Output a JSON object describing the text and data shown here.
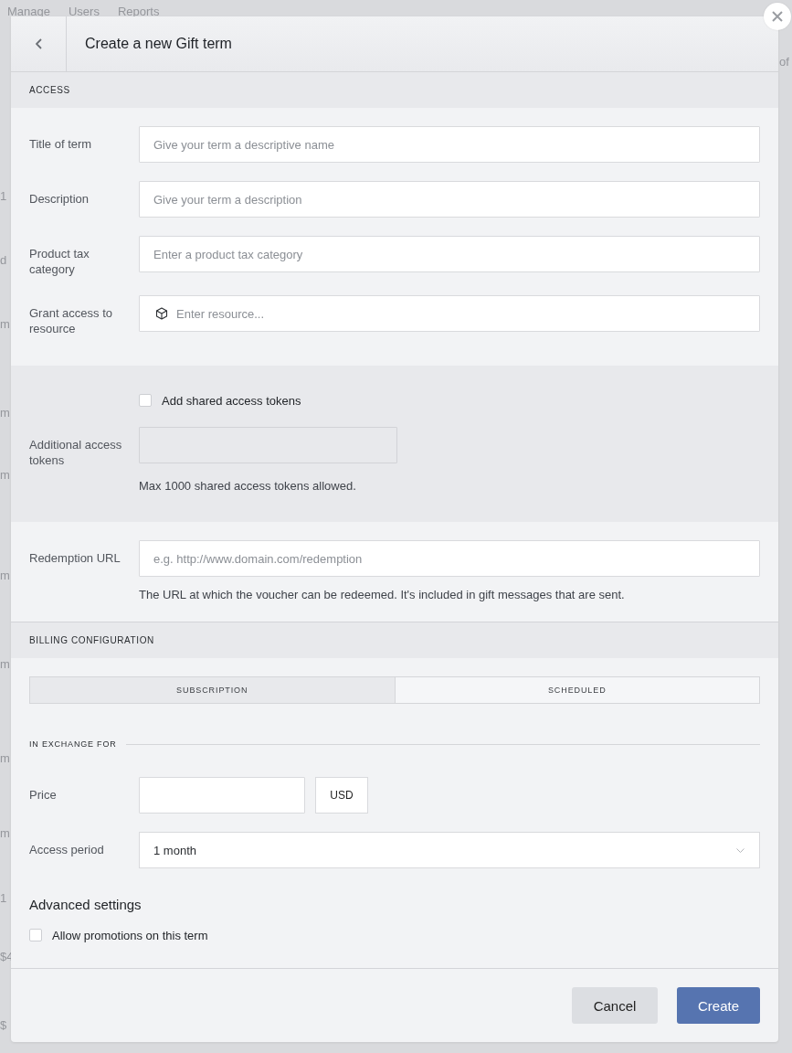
{
  "backdrop": {
    "nav": [
      {
        "label": "Manage"
      },
      {
        "label": "Users"
      },
      {
        "label": "Reports"
      }
    ],
    "right_fragment": "of",
    "left_fragments": [
      "1",
      "d",
      "m",
      "m",
      "m",
      "m",
      "m",
      "m",
      "m",
      "1",
      "$4",
      "$"
    ]
  },
  "dialog": {
    "title": "Create a new Gift term"
  },
  "access": {
    "heading": "ACCESS",
    "fields": [
      {
        "kind": "text",
        "label": "Title of term",
        "placeholder": "Give your term a descriptive name"
      },
      {
        "kind": "text",
        "label": "Description",
        "placeholder": "Give your term a description"
      },
      {
        "kind": "text",
        "label": "Product tax category",
        "placeholder": "Enter a product tax category"
      },
      {
        "kind": "resource",
        "label": "Grant access to resource",
        "placeholder": "Enter resource..."
      }
    ]
  },
  "shared_tokens": {
    "checkbox": {
      "label": "Add shared access tokens",
      "checked": false
    },
    "label": "Additional access tokens",
    "disabled": true,
    "help": "Max 1000 shared access tokens allowed."
  },
  "redemption": {
    "label": "Redemption URL",
    "placeholder": "e.g. http://www.domain.com/redemption",
    "help": "The URL at which the voucher can be redeemed. It's included in gift messages that are sent."
  },
  "billing": {
    "heading": "BILLING CONFIGURATION",
    "tabs": [
      {
        "label": "SUBSCRIPTION",
        "selected": true
      },
      {
        "label": "SCHEDULED",
        "selected": false
      }
    ],
    "subheading": "IN EXCHANGE FOR",
    "price": {
      "label": "Price",
      "currency": "USD"
    },
    "access_period": {
      "label": "Access period",
      "value": "1 month"
    }
  },
  "advanced": {
    "heading": "Advanced settings",
    "options": [
      {
        "label": "Allow promotions on this term",
        "checked": false
      }
    ]
  },
  "buttons": [
    {
      "kind": "secondary",
      "label": "Cancel"
    },
    {
      "kind": "primary",
      "label": "Create"
    }
  ]
}
